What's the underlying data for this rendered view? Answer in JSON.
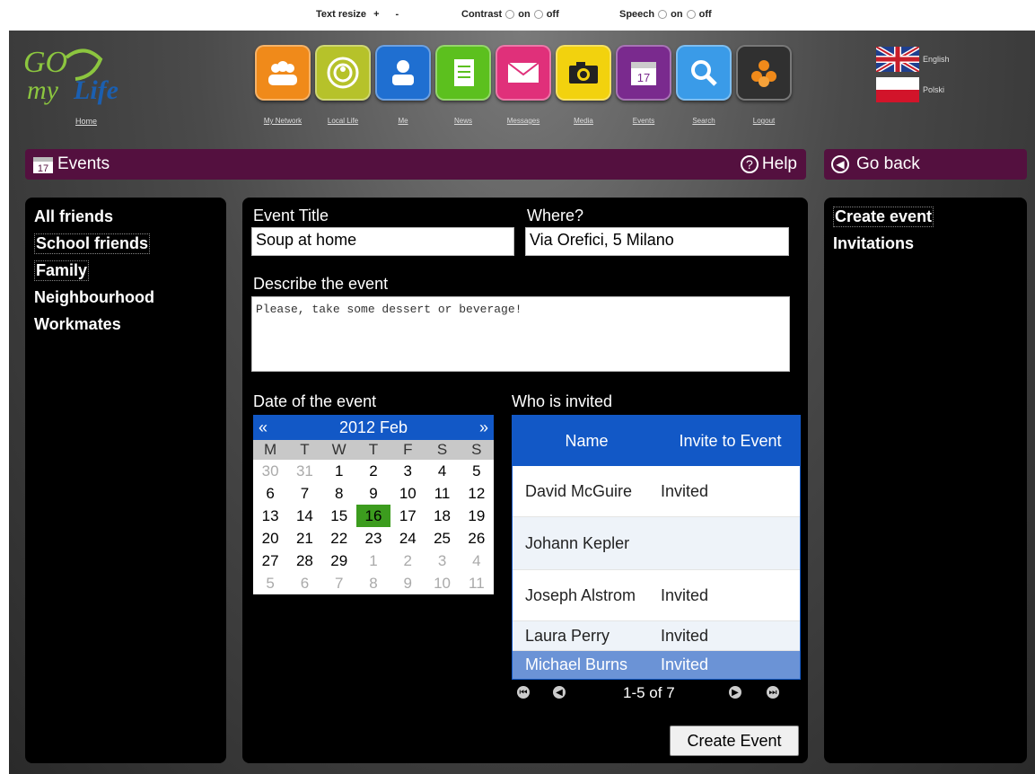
{
  "topbar": {
    "text_resize": "Text resize",
    "plus": "+",
    "minus": "-",
    "contrast": "Contrast",
    "speech": "Speech",
    "on": "on",
    "off": "off"
  },
  "header": {
    "logo_text": "GO my Life",
    "home": "Home",
    "nav": [
      {
        "label": "My Network",
        "icon": "network-icon",
        "color": "#f08a1a"
      },
      {
        "label": "Local Life",
        "icon": "local-life-icon",
        "color": "#b6c22a"
      },
      {
        "label": "Me",
        "icon": "person-icon",
        "color": "#1f6fd1"
      },
      {
        "label": "News",
        "icon": "news-icon",
        "color": "#5cc01e"
      },
      {
        "label": "Messages",
        "icon": "envelope-icon",
        "color": "#e0307a"
      },
      {
        "label": "Media",
        "icon": "camera-icon",
        "color": "#f2d20e"
      },
      {
        "label": "Events",
        "icon": "calendar-icon",
        "color": "#7a2a8e"
      },
      {
        "label": "Search",
        "icon": "search-icon",
        "color": "#3a9be8"
      },
      {
        "label": "Logout",
        "icon": "logout-icon",
        "color": "#303030"
      }
    ],
    "languages": [
      {
        "label": "English",
        "icon": "uk-flag-icon"
      },
      {
        "label": "Polski",
        "icon": "poland-flag-icon"
      }
    ]
  },
  "section": {
    "title": "Events",
    "calendar_day": "17",
    "help": "Help",
    "go_back": "Go back"
  },
  "left_nav": [
    "All friends",
    "School friends",
    "Family",
    "Neighbourhood",
    "Workmates"
  ],
  "right_nav": [
    "Create event",
    "Invitations"
  ],
  "form": {
    "event_title_label": "Event Title",
    "event_title_value": "Soup at home",
    "where_label": "Where?",
    "where_value": "Via Orefici, 5 Milano",
    "describe_label": "Describe the event",
    "describe_value": "Please, take some dessert or beverage!",
    "date_label": "Date of the event",
    "invited_label": "Who is invited"
  },
  "calendar": {
    "prev": "«",
    "next": "»",
    "month": "2012 Feb",
    "dow": [
      "M",
      "T",
      "W",
      "T",
      "F",
      "S",
      "S"
    ],
    "days": [
      "30",
      "31",
      "1",
      "2",
      "3",
      "4",
      "5",
      "6",
      "7",
      "8",
      "9",
      "10",
      "11",
      "12",
      "13",
      "14",
      "15",
      "16",
      "17",
      "18",
      "19",
      "20",
      "21",
      "22",
      "23",
      "24",
      "25",
      "26",
      "27",
      "28",
      "29",
      "1",
      "2",
      "3",
      "4",
      "5",
      "6",
      "7",
      "8",
      "9",
      "10",
      "11"
    ],
    "selected": "16"
  },
  "invite_table": {
    "headers": [
      "Name",
      "Invite to Event"
    ],
    "rows": [
      {
        "name": "David McGuire",
        "status": "Invited"
      },
      {
        "name": "Johann Kepler",
        "status": ""
      },
      {
        "name": "Joseph Alstrom",
        "status": "Invited"
      },
      {
        "name": "Laura Perry",
        "status": "Invited"
      },
      {
        "name": "Michael Burns",
        "status": "Invited"
      }
    ],
    "pager": "1-5 of 7"
  },
  "create_button": "Create Event"
}
